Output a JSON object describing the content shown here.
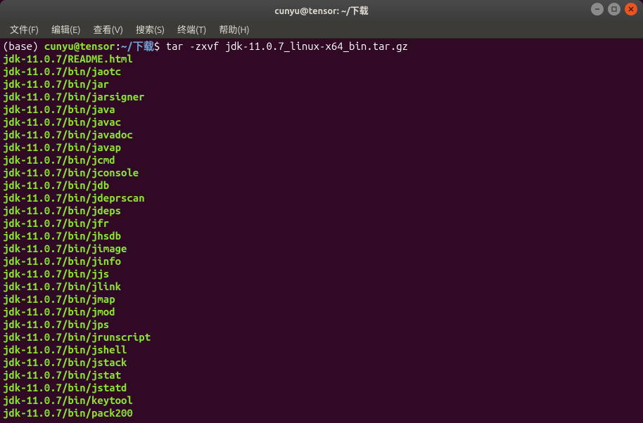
{
  "titlebar": {
    "title": "cunyu@tensor: ~/下载"
  },
  "menubar": {
    "items": [
      "文件(F)",
      "编辑(E)",
      "查看(V)",
      "搜索(S)",
      "终端(T)",
      "帮助(H)"
    ]
  },
  "prompt": {
    "env": "(base) ",
    "userhost": "cunyu@tensor",
    "colon": ":",
    "path": "~/下载",
    "dollar": "$ ",
    "command": "tar -zxvf jdk-11.0.7_linux-x64_bin.tar.gz"
  },
  "output": [
    "jdk-11.0.7/README.html",
    "jdk-11.0.7/bin/jaotc",
    "jdk-11.0.7/bin/jar",
    "jdk-11.0.7/bin/jarsigner",
    "jdk-11.0.7/bin/java",
    "jdk-11.0.7/bin/javac",
    "jdk-11.0.7/bin/javadoc",
    "jdk-11.0.7/bin/javap",
    "jdk-11.0.7/bin/jcmd",
    "jdk-11.0.7/bin/jconsole",
    "jdk-11.0.7/bin/jdb",
    "jdk-11.0.7/bin/jdeprscan",
    "jdk-11.0.7/bin/jdeps",
    "jdk-11.0.7/bin/jfr",
    "jdk-11.0.7/bin/jhsdb",
    "jdk-11.0.7/bin/jimage",
    "jdk-11.0.7/bin/jinfo",
    "jdk-11.0.7/bin/jjs",
    "jdk-11.0.7/bin/jlink",
    "jdk-11.0.7/bin/jmap",
    "jdk-11.0.7/bin/jmod",
    "jdk-11.0.7/bin/jps",
    "jdk-11.0.7/bin/jrunscript",
    "jdk-11.0.7/bin/jshell",
    "jdk-11.0.7/bin/jstack",
    "jdk-11.0.7/bin/jstat",
    "jdk-11.0.7/bin/jstatd",
    "jdk-11.0.7/bin/keytool",
    "jdk-11.0.7/bin/pack200"
  ]
}
